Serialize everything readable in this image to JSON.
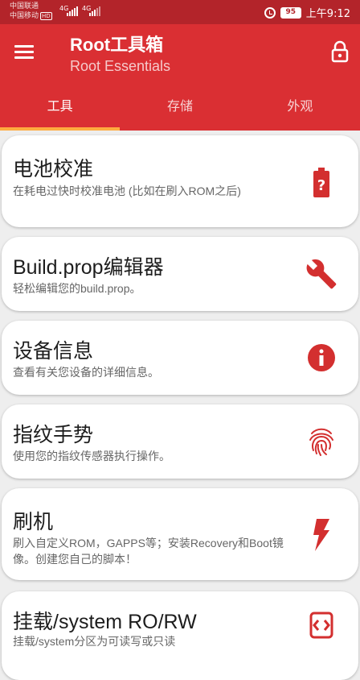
{
  "status_bar": {
    "carrier_1": "中国联通",
    "carrier_2": "中国移动",
    "hd_badge": "HD",
    "signal_1": "4G",
    "signal_2": "4G",
    "battery": "95",
    "time": "上午9:12"
  },
  "app_bar": {
    "title": "Root工具箱",
    "subtitle": "Root Essentials",
    "menu_icon": "menu-icon",
    "lock_icon": "lock-icon"
  },
  "tabs": [
    {
      "label": "工具",
      "active": true
    },
    {
      "label": "存储",
      "active": false
    },
    {
      "label": "外观",
      "active": false
    }
  ],
  "accent_colors": {
    "app_bar": "#da2f33",
    "status_bar": "#b3242a",
    "tab_indicator": "#ffab40",
    "icon": "#d32f2f"
  },
  "items": [
    {
      "title": "电池校准",
      "desc": "在耗电过快时校准电池 (比如在刷入ROM之后)",
      "icon": "battery-unknown-icon"
    },
    {
      "title": "Build.prop编辑器",
      "desc": "轻松编辑您的build.prop。",
      "icon": "wrench-icon"
    },
    {
      "title": "设备信息",
      "desc": "查看有关您设备的详细信息。",
      "icon": "info-icon"
    },
    {
      "title": "指纹手势",
      "desc": "使用您的指纹传感器执行操作。",
      "icon": "fingerprint-icon"
    },
    {
      "title": "刷机",
      "desc": "刷入自定义ROM，GAPPS等；安装Recovery和Boot镜像。创建您自己的脚本！",
      "icon": "flash-icon"
    },
    {
      "title": "挂载/system RO/RW",
      "desc": "挂载/system分区为可读写或只读",
      "icon": "swap-icon"
    }
  ]
}
